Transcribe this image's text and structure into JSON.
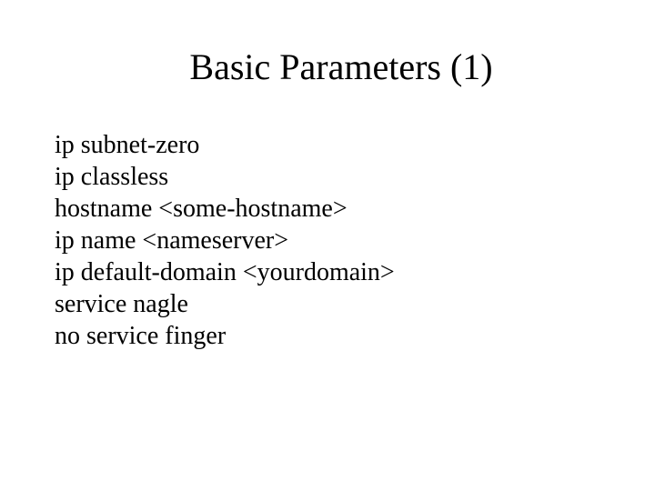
{
  "title": "Basic Parameters (1)",
  "lines": {
    "l0": "ip subnet-zero",
    "l1": "ip classless",
    "l2": "hostname <some-hostname>",
    "l3": "ip name <nameserver>",
    "l4": "ip default-domain <yourdomain>",
    "l5": "service nagle",
    "l6": "no service finger"
  }
}
